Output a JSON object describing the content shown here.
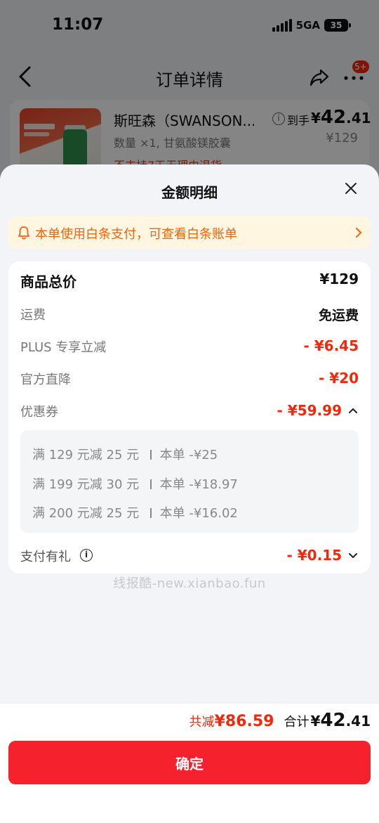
{
  "status_bar": {
    "time": "11:07",
    "network": "5GA",
    "battery": "35"
  },
  "nav": {
    "title": "订单详情",
    "badge": "5+"
  },
  "product": {
    "name": "斯旺森（SWANSON...",
    "spec": "数量 ×1, 甘氨酸镁胶囊",
    "price_label": "到手",
    "price_symbol": "¥",
    "price_int": "42",
    "price_dec": ".41",
    "original_price": "¥129",
    "note": "不支持7天无理由退货"
  },
  "sheet": {
    "title": "金额明细",
    "notice": "本单使用白条支付，可查看白条账单",
    "rows": [
      {
        "label": "商品总价",
        "value": "¥129"
      },
      {
        "label": "运费",
        "value": "免运费"
      },
      {
        "label": "PLUS 专享立减",
        "value": "- ¥6.45"
      },
      {
        "label": "官方直降",
        "value": "- ¥20"
      },
      {
        "label": "优惠券",
        "value": "- ¥59.99"
      },
      {
        "label": "支付有礼",
        "value": "- ¥0.15"
      }
    ],
    "coupons": [
      {
        "rule": "满 129 元减 25 元",
        "applied": "本单 -¥25"
      },
      {
        "rule": "满 199 元减 30 元",
        "applied": "本单 -¥18.97"
      },
      {
        "rule": "满 200 元减 25 元",
        "applied": "本单 -¥16.02"
      }
    ],
    "watermark": "线报酷-new.xianbao.fun"
  },
  "footer": {
    "save_label": "共减",
    "save_value": "¥86.59",
    "total_label": "合计",
    "total_symbol": "¥",
    "total_int": "42",
    "total_dec": ".41",
    "confirm_label": "确定"
  },
  "colors": {
    "accent_red": "#f2270c",
    "notice_orange": "#f2640c",
    "notice_bg": "#fff6e2"
  }
}
